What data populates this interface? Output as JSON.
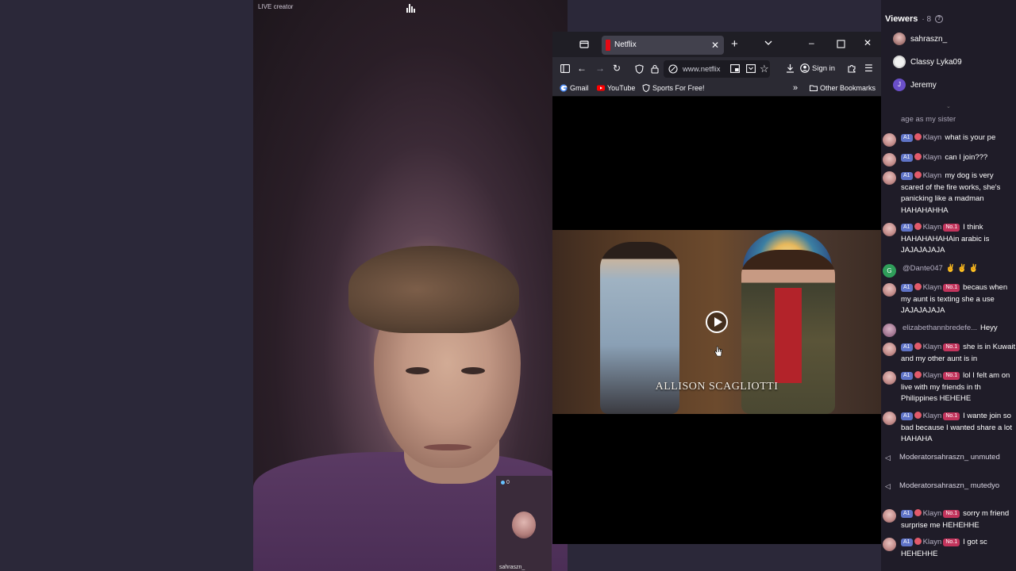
{
  "stream": {
    "live_creator_label": "LIVE creator",
    "guest": {
      "count": "0",
      "name": "sahraszn_"
    }
  },
  "browser": {
    "tab_title": "Netflix",
    "url": "www.netflix",
    "signin_label": "Sign in",
    "bookmarks": [
      {
        "label": "Gmail",
        "icon": "google-icon"
      },
      {
        "label": "YouTube",
        "icon": "youtube-icon"
      },
      {
        "label": "Sports For Free!",
        "icon": "shield-icon"
      }
    ],
    "other_bookmarks_label": "Other Bookmarks",
    "video": {
      "caption": "ALLISON SCAGLIOTTI"
    },
    "colors": {
      "titlebar": "#1f1e25",
      "toolbar": "#2b2a33",
      "netflix_red": "#e50914"
    }
  },
  "chat": {
    "viewers_title": "Viewers",
    "viewers_count": "8",
    "viewers": [
      {
        "name": "sahraszn_",
        "avatar": "photo"
      },
      {
        "name": "Classy Lyka09",
        "avatar": "white"
      },
      {
        "name": "Jeremy",
        "avatar_letter": "J"
      }
    ],
    "partial_message": "age as my sister",
    "messages": [
      {
        "level": "A1",
        "user": "Klayn",
        "rank": "",
        "text": "what is your pe"
      },
      {
        "level": "A1",
        "user": "Klayn",
        "rank": "",
        "text": "can I join???"
      },
      {
        "level": "A1",
        "user": "Klayn",
        "rank": "",
        "text": "my dog is very scared of the fire works, she's panicking like a madman HAHAHAHHA"
      },
      {
        "level": "A1",
        "user": "Klayn",
        "rank": "No.1",
        "text": "I think HAHAHAHAHAin arabic is JAJAJAJAJA"
      },
      {
        "avatar_letter": "G",
        "user": "@Dante047",
        "text": "✌ ✌ ✌"
      },
      {
        "level": "A1",
        "user": "Klayn",
        "rank": "No.1",
        "text": "becaus when my aunt is texting she a use JAJAJAJAJA"
      },
      {
        "user": "elizabethannbredefe...",
        "text": "Heyy"
      },
      {
        "level": "A1",
        "user": "Klayn",
        "rank": "No.1",
        "text": "she is in Kuwait and my other aunt is in"
      },
      {
        "level": "A1",
        "user": "Klayn",
        "rank": "No.1",
        "text": "lol I felt am on live with my friends in th Philippines HEHEHE"
      },
      {
        "level": "A1",
        "user": "Klayn",
        "rank": "No.1",
        "text": "I wante join so bad because I wanted share a lot HAHAHA"
      },
      {
        "level": "A1",
        "user": "Klayn",
        "rank": "No.1",
        "text": "sorry m friend surprise me HEHEHHE"
      },
      {
        "level": "A1",
        "user": "Klayn",
        "rank": "No.1",
        "text": "I got sc HEHEHHE"
      }
    ],
    "system_messages": [
      {
        "text": "Moderatorsahraszn_ unmuted"
      },
      {
        "text": "Moderatorsahraszn_ mutedyo"
      }
    ]
  }
}
